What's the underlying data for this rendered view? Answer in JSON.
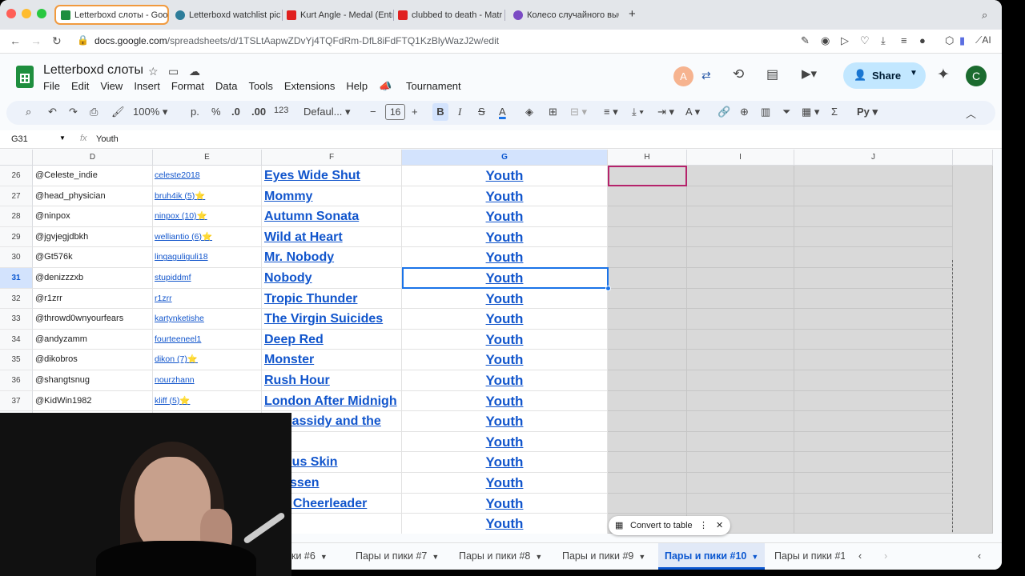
{
  "browser": {
    "tabs": [
      {
        "title": "Letterboxd слоты - Goog",
        "color": "#1e8e3e"
      },
      {
        "title": "Letterboxd watchlist pic",
        "color": "#2d7d9a"
      },
      {
        "title": "Kurt Angle - Medal (Entr",
        "color": "#e02020"
      },
      {
        "title": "clubbed to death - Matr",
        "color": "#e02020"
      },
      {
        "title": "Колесо случайного выб",
        "color": "#7b4bc4"
      }
    ],
    "new_tab": "+",
    "url_host": "docs.google.com",
    "url_path": "/spreadsheets/d/1TSLtAapwZDvYj4TQFdRm-DfL8iFdFTQ1KzBlyWazJ2w/edit",
    "ai_label": "AI"
  },
  "doc": {
    "title": "Letterboxd слоты",
    "menu": [
      "File",
      "Edit",
      "View",
      "Insert",
      "Format",
      "Data",
      "Tools",
      "Extensions",
      "Help",
      "Tournament"
    ],
    "avatar_a": "A",
    "share_label": "Share",
    "avatar_c": "C"
  },
  "toolbar": {
    "zoom": "100%",
    "currency": "р.",
    "percent": "%",
    "dec_minus": ".0",
    "dec_plus": ".00",
    "number_format": "123",
    "font": "Defaul...",
    "font_size": "16",
    "bold": "B",
    "italic": "I",
    "text_color": "A"
  },
  "formula_bar": {
    "name_box": "G31",
    "fx": "fx",
    "value": "Youth"
  },
  "columns": [
    "D",
    "E",
    "F",
    "G",
    "H",
    "I",
    "J"
  ],
  "rows": [
    {
      "n": "26",
      "d": "@Celeste_indie",
      "e": "celeste2018",
      "f": "Eyes Wide Shut",
      "g": "Youth"
    },
    {
      "n": "27",
      "d": "@head_physician",
      "e": "bruh4ik (5)⭐",
      "f": "Mommy",
      "g": "Youth"
    },
    {
      "n": "28",
      "d": "@ninpox",
      "e": "ninpox (10)⭐",
      "f": "Autumn Sonata",
      "g": "Youth"
    },
    {
      "n": "29",
      "d": "@jgvjegjdbkh",
      "e": "welliantio (6)⭐",
      "f": "Wild at Heart",
      "g": "Youth"
    },
    {
      "n": "30",
      "d": "@Gt576k",
      "e": "lingaguliguli18",
      "f": "Mr. Nobody",
      "g": "Youth"
    },
    {
      "n": "31",
      "d": "@denizzzxb",
      "e": "stupiddmf",
      "f": "Nobody",
      "g": "Youth"
    },
    {
      "n": "32",
      "d": "@r1zrr",
      "e": "r1zrr",
      "f": "Tropic Thunder",
      "g": "Youth"
    },
    {
      "n": "33",
      "d": "@throwd0wnyourfears",
      "e": "kartynketishe",
      "f": "The Virgin Suicides",
      "g": "Youth"
    },
    {
      "n": "34",
      "d": "@andyzamm",
      "e": "fourteeneel1",
      "f": "Deep Red",
      "g": "Youth"
    },
    {
      "n": "35",
      "d": "@dikobros",
      "e": "dikon (7)⭐",
      "f": "Monster",
      "g": "Youth"
    },
    {
      "n": "36",
      "d": "@shangtsnug",
      "e": "nourzhann",
      "f": "Rush Hour",
      "g": "Youth"
    },
    {
      "n": "37",
      "d": "@KidWin1982",
      "e": "kliff (5)⭐",
      "f": "London After Midnigh",
      "g": "Youth"
    },
    {
      "n": "",
      "d": "",
      "e": "",
      "f": "ch Cassidy and the",
      "g": "Youth"
    },
    {
      "n": "",
      "d": "",
      "e": "",
      "f": "",
      "g": "Youth"
    },
    {
      "n": "",
      "d": "",
      "e": "",
      "f": "terious Skin",
      "g": "Youth"
    },
    {
      "n": "",
      "d": "",
      "e": "",
      "f": "catessen",
      "g": "Youth"
    },
    {
      "n": "",
      "d": "",
      "e": "",
      "f": "'m a Cheerleader",
      "g": "Youth"
    },
    {
      "n": "",
      "d": "",
      "e": "",
      "f": "",
      "g": "Youth"
    }
  ],
  "convert_chip": "Convert to table",
  "sheet_tabs": [
    "ики #6",
    "Пары и пики #7",
    "Пары и пики #8",
    "Пары и пики #9",
    "Пары и пики #10",
    "Пары и пики #1"
  ]
}
